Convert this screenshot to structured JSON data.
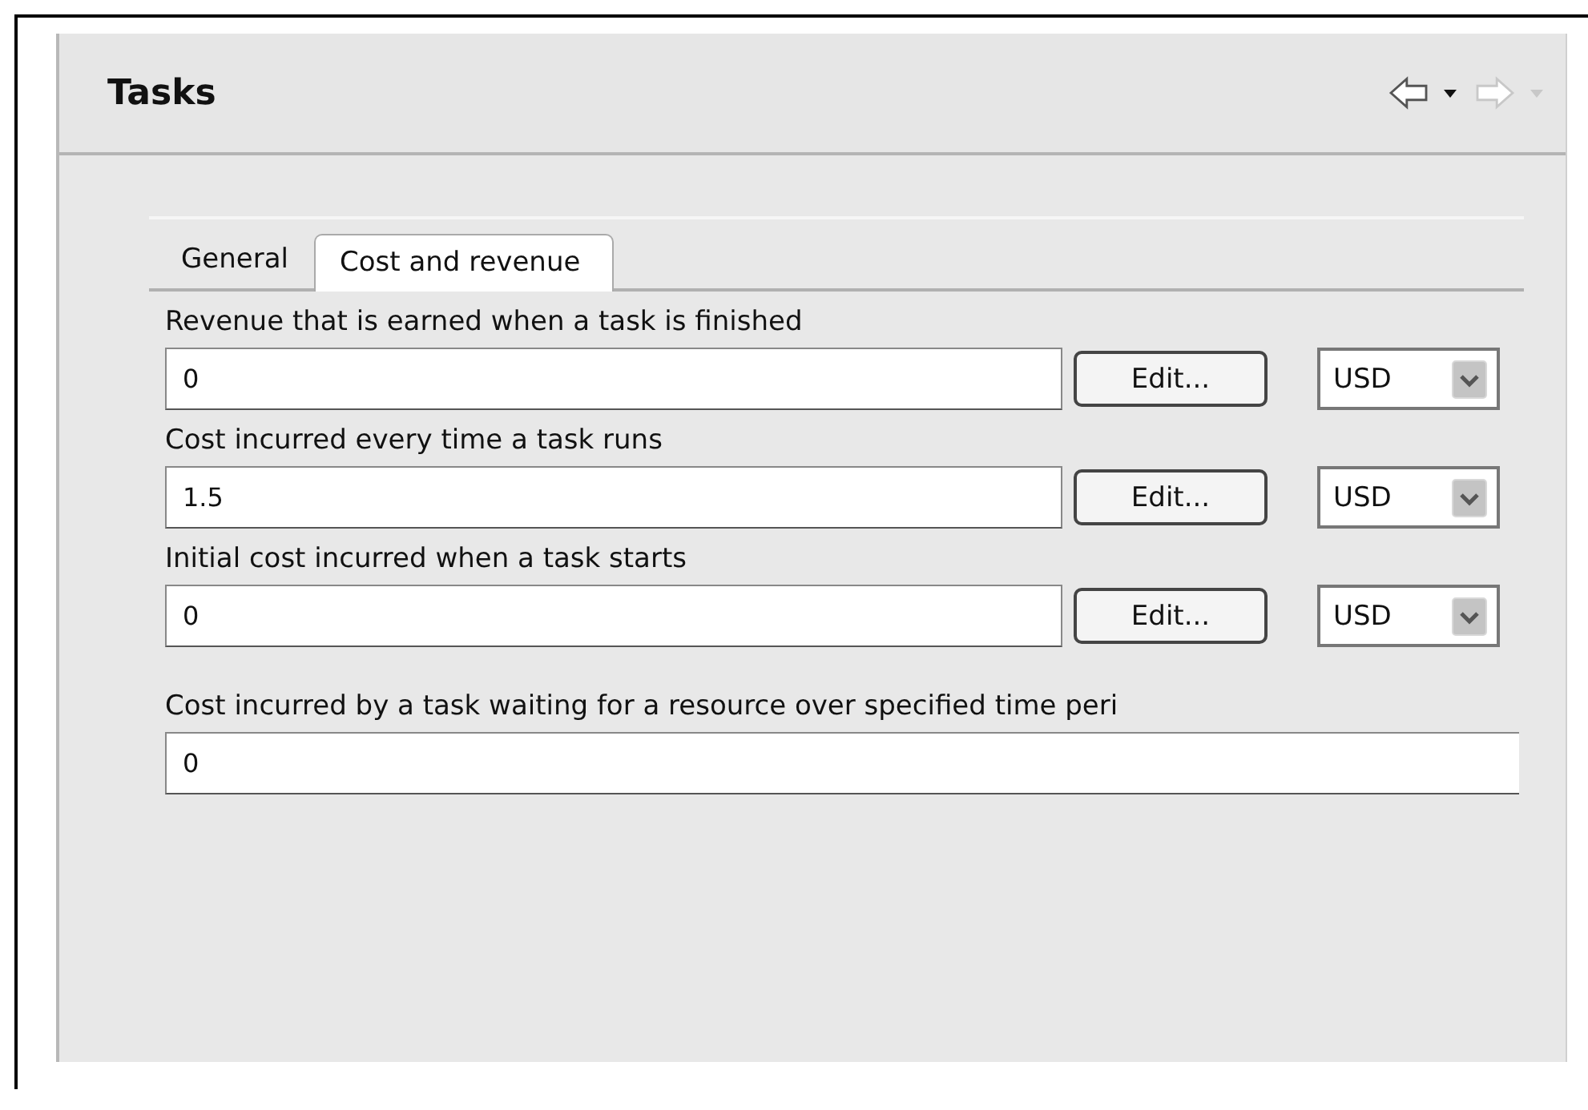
{
  "panel": {
    "title": "Tasks",
    "nav": [
      {
        "kind": "back",
        "disabled": false
      },
      {
        "kind": "forward",
        "disabled": true
      }
    ]
  },
  "tabs": [
    {
      "label": "General",
      "selected": false
    },
    {
      "label": "Cost and revenue",
      "selected": true
    }
  ],
  "fields": [
    {
      "kind": "currency",
      "label": "Revenue that is earned when a task is finished",
      "value": "0",
      "button": "Edit...",
      "currency": "USD"
    },
    {
      "kind": "currency",
      "label": "Cost incurred every time a task runs",
      "value": "1.5",
      "button": "Edit...",
      "currency": "USD"
    },
    {
      "kind": "currency",
      "label": "Initial cost incurred when a task starts",
      "value": "0",
      "button": "Edit...",
      "currency": "USD"
    },
    {
      "kind": "plain",
      "label": "Cost incurred by a task waiting for a resource over specified time peri",
      "value": "0"
    }
  ]
}
